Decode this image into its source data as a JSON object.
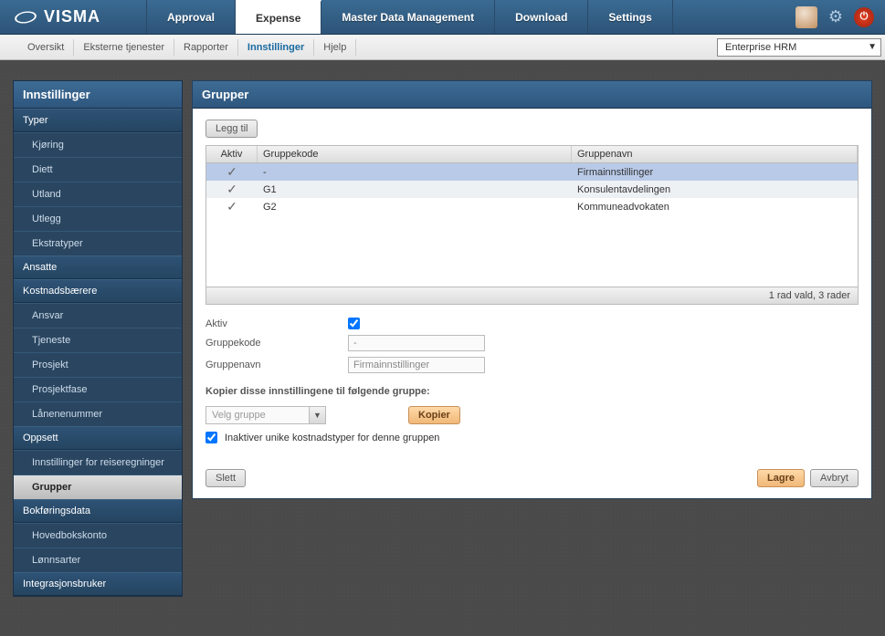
{
  "logo": "VISMA",
  "topnav": [
    {
      "label": "Approval",
      "active": false
    },
    {
      "label": "Expense",
      "active": true
    },
    {
      "label": "Master Data Management",
      "active": false
    },
    {
      "label": "Download",
      "active": false
    },
    {
      "label": "Settings",
      "active": false
    }
  ],
  "subnav": [
    {
      "label": "Oversikt",
      "active": false
    },
    {
      "label": "Eksterne tjenester",
      "active": false
    },
    {
      "label": "Rapporter",
      "active": false
    },
    {
      "label": "Innstillinger",
      "active": true
    },
    {
      "label": "Hjelp",
      "active": false
    }
  ],
  "context_dropdown": "Enterprise HRM",
  "sidebar": {
    "title": "Innstillinger",
    "sections": [
      {
        "header": "Typer",
        "items": [
          "Kjøring",
          "Diett",
          "Utland",
          "Utlegg",
          "Ekstratyper"
        ]
      },
      {
        "header": "Ansatte",
        "items": []
      },
      {
        "header": "Kostnadsbærere",
        "items": [
          "Ansvar",
          "Tjeneste",
          "Prosjekt",
          "Prosjektfase",
          "Lånenenummer"
        ]
      },
      {
        "header": "Oppsett",
        "items": [
          "Innstillinger for reiseregninger",
          "Grupper"
        ]
      },
      {
        "header": "Bokføringsdata",
        "items": [
          "Hovedbokskonto",
          "Lønnsarter"
        ]
      },
      {
        "header": "Integrasjonsbruker",
        "items": []
      }
    ],
    "active_item": "Grupper"
  },
  "content": {
    "title": "Grupper",
    "add_btn": "Legg til",
    "grid": {
      "cols": {
        "aktiv": "Aktiv",
        "kode": "Gruppekode",
        "navn": "Gruppenavn"
      },
      "rows": [
        {
          "aktiv": true,
          "kode": "-",
          "navn": "Firmainnstillinger",
          "selected": true
        },
        {
          "aktiv": true,
          "kode": "G1",
          "navn": "Konsulentavdelingen",
          "selected": false
        },
        {
          "aktiv": true,
          "kode": "G2",
          "navn": "Kommuneadvokaten",
          "selected": false
        }
      ],
      "footer": "1 rad vald, 3 rader"
    },
    "form": {
      "aktiv_label": "Aktiv",
      "aktiv_value": true,
      "kode_label": "Gruppekode",
      "kode_value": "-",
      "navn_label": "Gruppenavn",
      "navn_value": "Firmainnstillinger"
    },
    "copy": {
      "header": "Kopier disse innstillingene til følgende gruppe:",
      "dropdown_placeholder": "Velg gruppe",
      "btn": "Kopier",
      "checkbox_checked": true,
      "checkbox_label": "Inaktiver unike kostnadstyper for denne gruppen"
    },
    "footer": {
      "delete": "Slett",
      "save": "Lagre",
      "cancel": "Avbryt"
    }
  }
}
